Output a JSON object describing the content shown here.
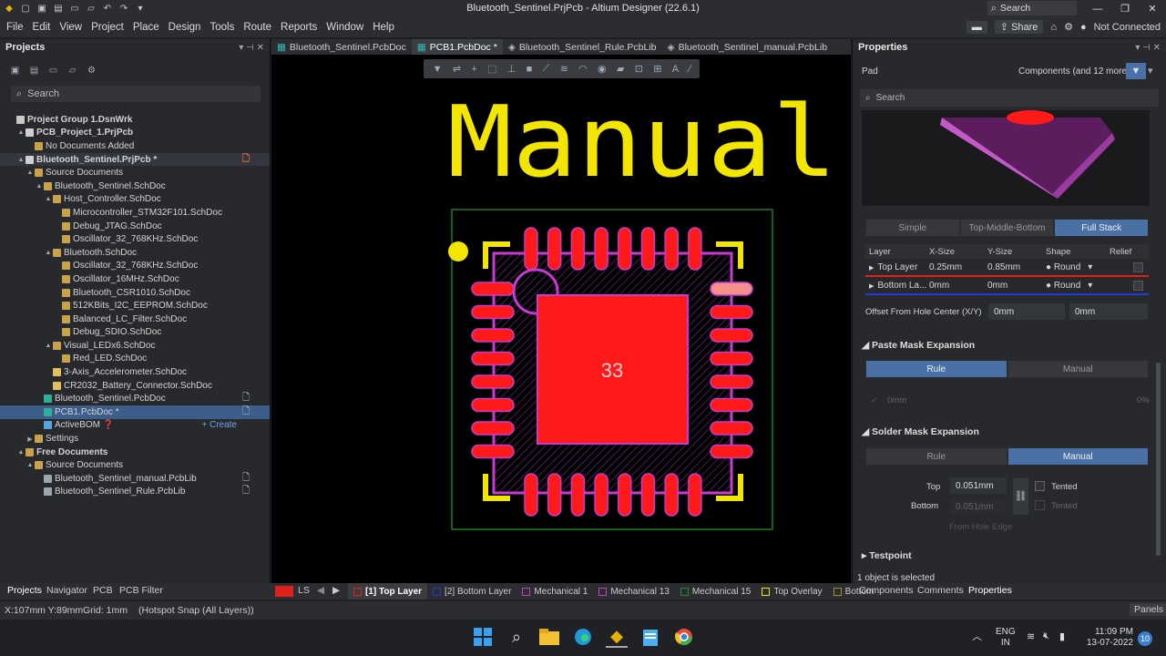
{
  "titlebar": {
    "title": "Bluetooth_Sentinel.PrjPcb - Altium Designer (22.6.1)",
    "search": "Search"
  },
  "menu": {
    "items": [
      "File",
      "Edit",
      "View",
      "Project",
      "Place",
      "Design",
      "Tools",
      "Route",
      "Reports",
      "Window",
      "Help"
    ],
    "share": "Share",
    "connection": "Not Connected"
  },
  "projects": {
    "title": "Projects",
    "search_placeholder": "Search",
    "tree": [
      {
        "label": "Project Group 1.DsnWrk",
        "indent": 0,
        "bold": true,
        "icon": "workspace",
        "tw": ""
      },
      {
        "label": "PCB_Project_1.PrjPcb",
        "indent": 1,
        "bold": true,
        "icon": "project",
        "tw": "▲"
      },
      {
        "label": "No Documents Added",
        "indent": 2,
        "icon": "folder",
        "tw": ""
      },
      {
        "label": "Bluetooth_Sentinel.PrjPcb *",
        "indent": 1,
        "bold": true,
        "icon": "project",
        "tw": "▲",
        "badge": "🗋",
        "hl": true
      },
      {
        "label": "Source Documents",
        "indent": 2,
        "icon": "folder",
        "tw": "▲"
      },
      {
        "label": "Bluetooth_Sentinel.SchDoc",
        "indent": 3,
        "icon": "folder",
        "tw": "▲"
      },
      {
        "label": "Host_Controller.SchDoc",
        "indent": 4,
        "icon": "folder",
        "tw": "▲"
      },
      {
        "label": "Microcontroller_STM32F101.SchDoc",
        "indent": 5,
        "icon": "folder",
        "tw": ""
      },
      {
        "label": "Debug_JTAG.SchDoc",
        "indent": 5,
        "icon": "folder",
        "tw": ""
      },
      {
        "label": "Oscillator_32_768KHz.SchDoc",
        "indent": 5,
        "icon": "folder",
        "tw": ""
      },
      {
        "label": "Bluetooth.SchDoc",
        "indent": 4,
        "icon": "folder",
        "tw": "▲"
      },
      {
        "label": "Oscillator_32_768KHz.SchDoc",
        "indent": 5,
        "icon": "folder",
        "tw": ""
      },
      {
        "label": "Oscillator_16MHz.SchDoc",
        "indent": 5,
        "icon": "folder",
        "tw": ""
      },
      {
        "label": "Bluetooth_CSR1010.SchDoc",
        "indent": 5,
        "icon": "folder",
        "tw": ""
      },
      {
        "label": "512KBits_I2C_EEPROM.SchDoc",
        "indent": 5,
        "icon": "folder",
        "tw": ""
      },
      {
        "label": "Balanced_LC_Filter.SchDoc",
        "indent": 5,
        "icon": "folder",
        "tw": ""
      },
      {
        "label": "Debug_SDIO.SchDoc",
        "indent": 5,
        "icon": "folder",
        "tw": ""
      },
      {
        "label": "Visual_LEDx6.SchDoc",
        "indent": 4,
        "icon": "folder",
        "tw": "▲"
      },
      {
        "label": "Red_LED.SchDoc",
        "indent": 5,
        "icon": "folder",
        "tw": ""
      },
      {
        "label": "3-Axis_Accelerometer.SchDoc",
        "indent": 4,
        "icon": "sch",
        "tw": ""
      },
      {
        "label": "CR2032_Battery_Connector.SchDoc",
        "indent": 4,
        "icon": "sch",
        "tw": ""
      },
      {
        "label": "Bluetooth_Sentinel.PcbDoc",
        "indent": 3,
        "icon": "pcb",
        "tw": "",
        "badge": "🗋"
      },
      {
        "label": "PCB1.PcbDoc *",
        "indent": 3,
        "icon": "pcb",
        "tw": "",
        "badge": "🗋",
        "sel": true
      },
      {
        "label": "ActiveBOM ❓",
        "indent": 3,
        "icon": "bom",
        "tw": "",
        "right": "+ Create"
      },
      {
        "label": "Settings",
        "indent": 2,
        "icon": "folder",
        "tw": "▶"
      },
      {
        "label": "Free Documents",
        "indent": 1,
        "bold": true,
        "icon": "folder",
        "tw": "▲"
      },
      {
        "label": "Source Documents",
        "indent": 2,
        "icon": "folder",
        "tw": "▲"
      },
      {
        "label": "Bluetooth_Sentinel_manual.PcbLib",
        "indent": 3,
        "icon": "lib",
        "tw": "",
        "badge": "🗋"
      },
      {
        "label": "Bluetooth_Sentinel_Rule.PcbLib",
        "indent": 3,
        "icon": "lib",
        "tw": "",
        "badge": "🗋"
      }
    ]
  },
  "doctabs": [
    "Bluetooth_Sentinel.PcbDoc",
    "PCB1.PcbDoc *",
    "Bluetooth_Sentinel_Rule.PcbLib",
    "Bluetooth_Sentinel_manual.PcbLib"
  ],
  "canvas": {
    "overlay_text": "Manual",
    "pad_number": "33"
  },
  "properties": {
    "title": "Properties",
    "type": "Pad",
    "filter": "Components (and 12 more)",
    "search_placeholder": "Search",
    "stack_modes": [
      "Simple",
      "Top-Middle-Bottom",
      "Full Stack"
    ],
    "layer_table": {
      "headers": [
        "Layer",
        "X-Size",
        "Y-Size",
        "Shape",
        "Relief"
      ],
      "rows": [
        {
          "layer": "Top Layer",
          "x": "0.25mm",
          "y": "0.85mm",
          "shape": "Round",
          "color": "#e0211b"
        },
        {
          "layer": "Bottom La...",
          "x": "0mm",
          "y": "0mm",
          "shape": "Round",
          "color": "#1f3bd8"
        }
      ]
    },
    "offset_label": "Offset From Hole Center (X/Y)",
    "offset_x": "0mm",
    "offset_y": "0mm",
    "paste": {
      "title": "Paste Mask Expansion",
      "rule": "Rule",
      "manual": "Manual",
      "value": "0mm",
      "pct": "0%"
    },
    "solder": {
      "title": "Solder Mask Expansion",
      "rule": "Rule",
      "manual": "Manual",
      "top_label": "Top",
      "top_value": "0.051mm",
      "bottom_label": "Bottom",
      "bottom_value": "0.051mm",
      "tented": "Tented",
      "tented2": "Tented",
      "from_hole": "From Hole Edge"
    },
    "testpoint": "Testpoint",
    "selection": "1 object is selected"
  },
  "layerbar": {
    "ls": "LS",
    "layers": [
      {
        "name": "[1] Top Layer",
        "color": "#e0211b",
        "active": true
      },
      {
        "name": "[2] Bottom Layer",
        "color": "#1f3bd8"
      },
      {
        "name": "Mechanical 1",
        "color": "#c040c0"
      },
      {
        "name": "Mechanical 13",
        "color": "#c040c0"
      },
      {
        "name": "Mechanical 15",
        "color": "#1f8a3a"
      },
      {
        "name": "Top Overlay",
        "color": "#f0e000"
      },
      {
        "name": "Bottom",
        "color": "#a09020"
      }
    ]
  },
  "bottomtabs_left": [
    "Projects",
    "Navigator",
    "PCB",
    "PCB Filter"
  ],
  "bottomtabs_right": [
    "Components",
    "Comments",
    "Properties"
  ],
  "status": {
    "coords": "X:107mm Y:89mm",
    "grid": "Grid: 1mm",
    "snap": "(Hotspot Snap (All Layers))",
    "panels": "Panels"
  },
  "taskbar": {
    "lang1": "ENG",
    "lang2": "IN",
    "time": "11:09 PM",
    "date": "13-07-2022",
    "notif": "10"
  }
}
